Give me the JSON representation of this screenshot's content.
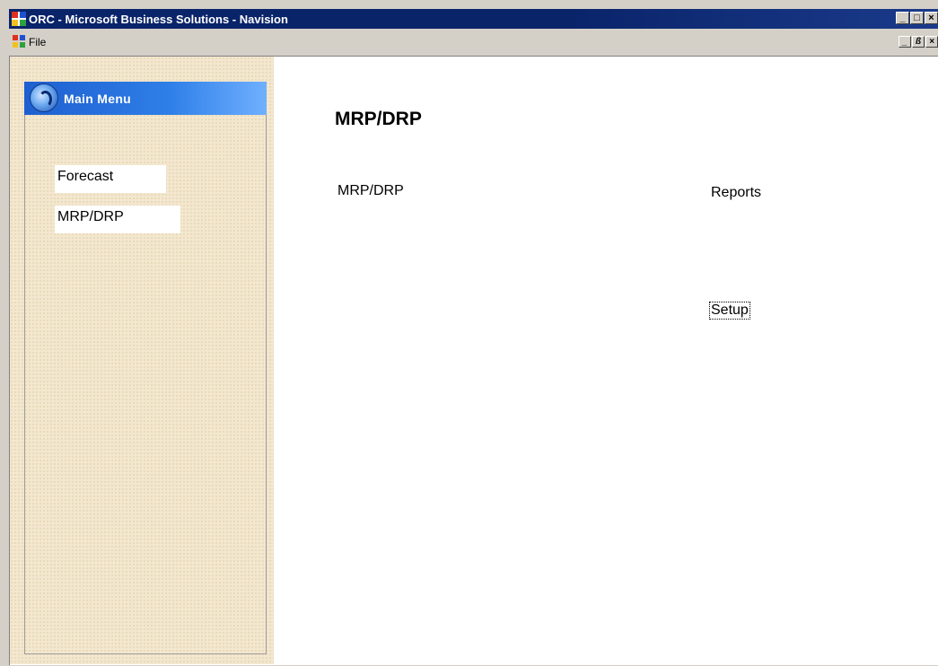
{
  "window": {
    "title": "ORC - Microsoft Business Solutions - Navision",
    "buttons": [
      "minimize-icon",
      "maximize-icon",
      "close-icon"
    ]
  },
  "menubar": {
    "file_label": "File",
    "mdi_buttons": [
      "minimize-icon",
      "restore-icon",
      "close-icon"
    ]
  },
  "sidebar": {
    "header": "Main Menu",
    "items": [
      {
        "label": "Forecast"
      },
      {
        "label": "MRP/DRP"
      }
    ]
  },
  "main": {
    "title": "MRP/DRP",
    "links": {
      "mrp": "MRP/DRP",
      "reports": "Reports",
      "setup": "Setup"
    }
  },
  "colors": {
    "titlebar": "#0a246a",
    "header_blue": "#2f7fe8",
    "sidebar_bg": "#f3e7cf"
  }
}
